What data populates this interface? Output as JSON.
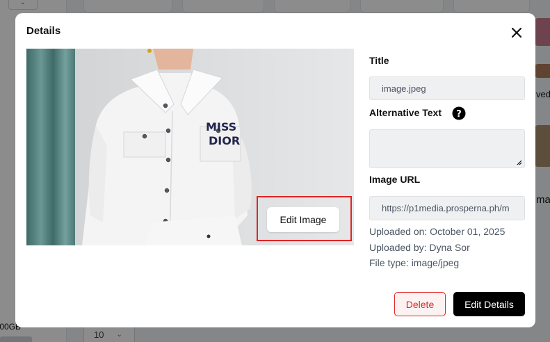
{
  "background": {
    "storage_text": ".00GB",
    "page_size": "10",
    "cut_texts": [
      "ved-",
      "ma"
    ]
  },
  "modal": {
    "title": "Details",
    "edit_image_label": "Edit Image",
    "fields": {
      "title_label": "Title",
      "title_value": "image.jpeg",
      "alt_label": "Alternative Text",
      "alt_value": "",
      "url_label": "Image URL",
      "url_value": "https://p1media.prosperna.ph/m"
    },
    "meta": {
      "uploaded_on": "Uploaded on: October 01, 2025",
      "uploaded_by": "Uploaded by: Dyna Sor",
      "file_type": "File type: image/jpeg"
    },
    "actions": {
      "delete_label": "Delete",
      "edit_details_label": "Edit Details"
    },
    "image_text": {
      "line1": "MISS",
      "line2": "DIOR"
    }
  },
  "colors": {
    "danger": "#e02424",
    "primary_button": "#000000",
    "field_bg": "#eff0f2"
  }
}
